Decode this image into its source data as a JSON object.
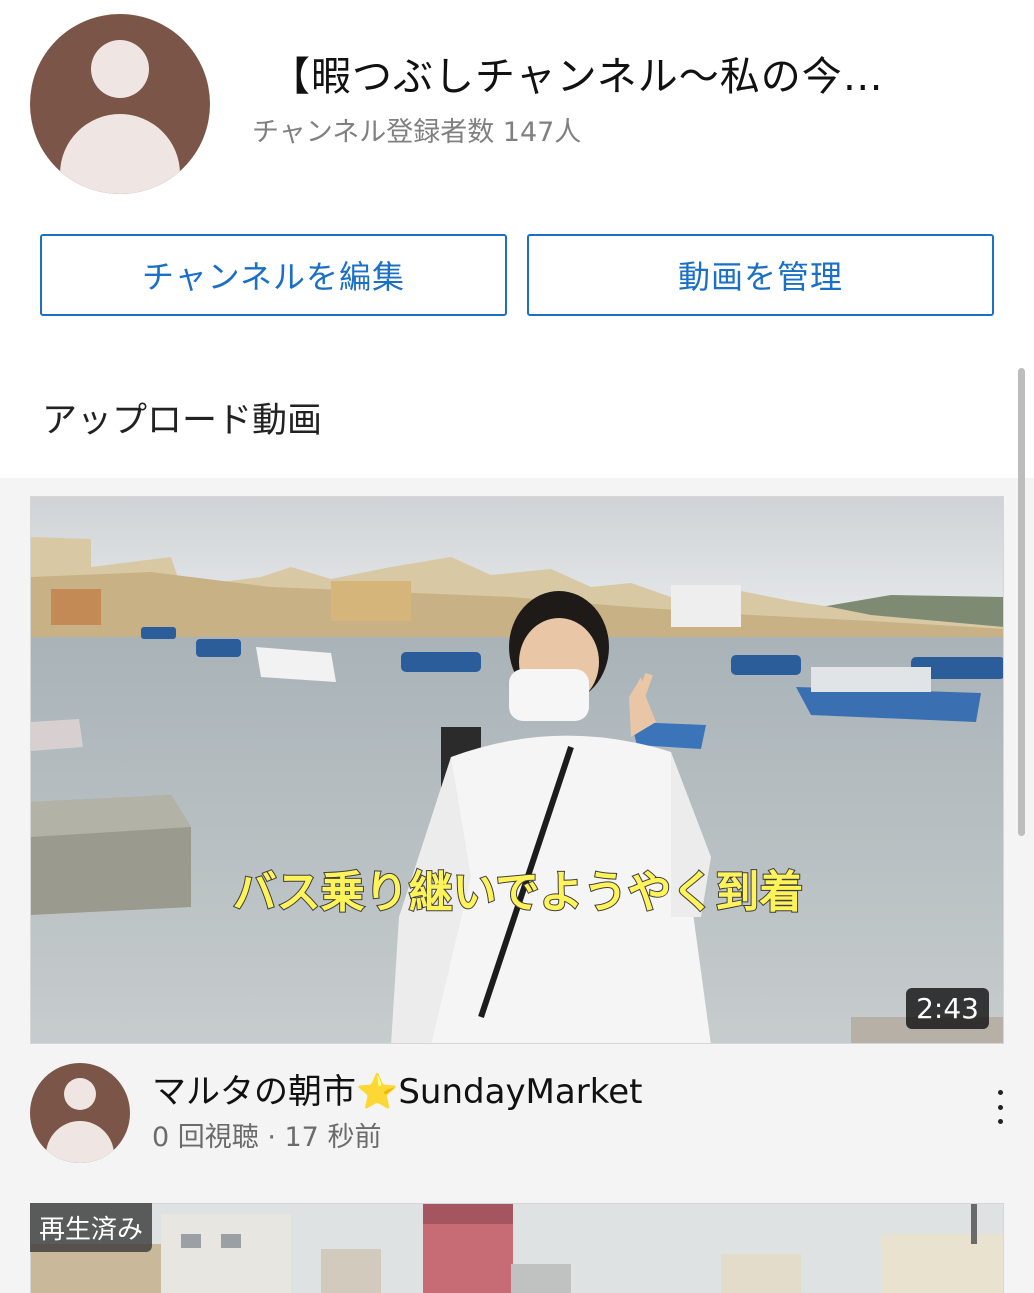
{
  "channel": {
    "title": "【暇つぶしチャンネル〜私の今…",
    "subscribers": "チャンネル登録者数 147人"
  },
  "actions": {
    "edit_label": "チャンネルを編集",
    "manage_label": "動画を管理"
  },
  "section": {
    "title": "アップロード動画"
  },
  "videos": [
    {
      "title_prefix": "マルタの朝市",
      "title_star": "⭐",
      "title_suffix": "SundayMarket",
      "meta": "0 回視聴 · 17 秒前",
      "duration": "2:43",
      "caption": "バス乗り継いでようやく到着"
    },
    {
      "badge": "再生済み"
    }
  ],
  "colors": {
    "accent": "#1a6fc6",
    "avatar": "#7a5548"
  }
}
